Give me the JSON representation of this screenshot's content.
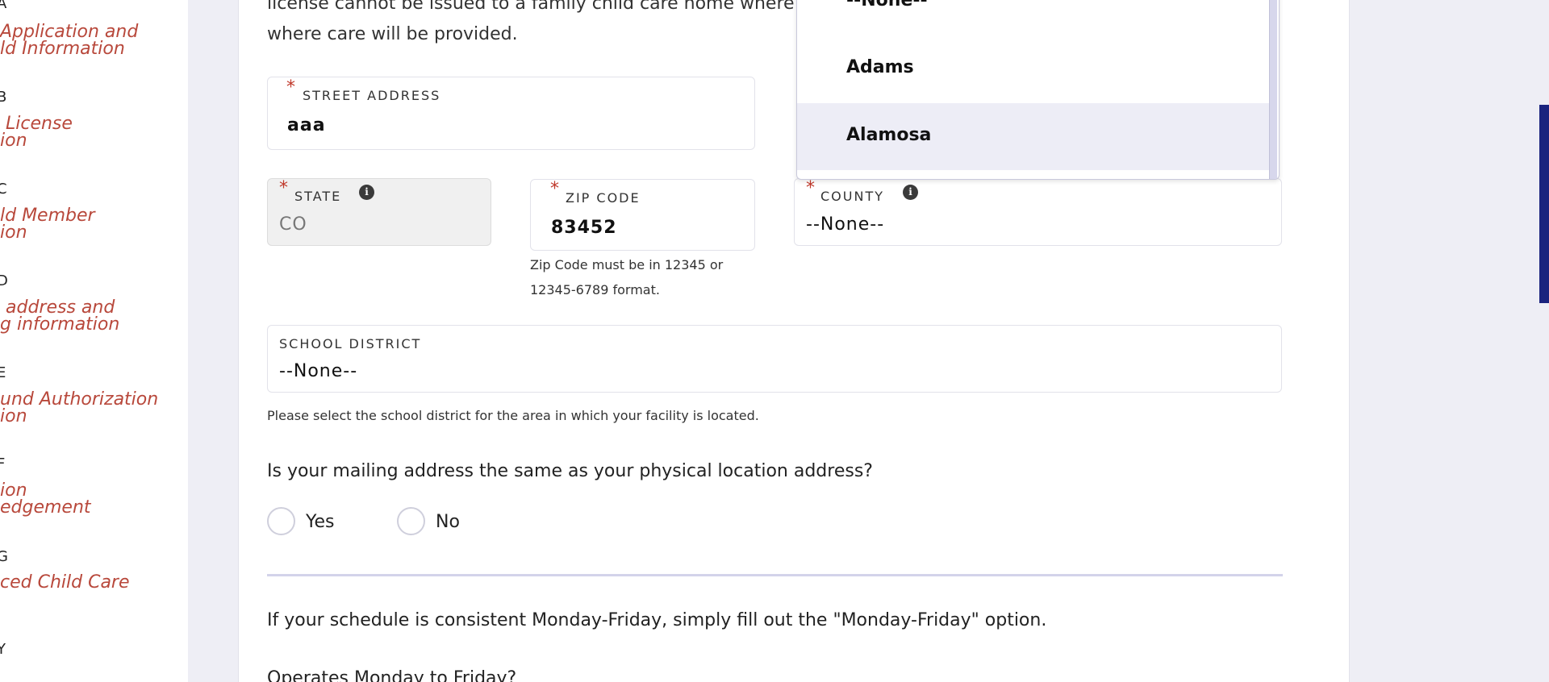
{
  "sidebar": {
    "steps": [
      {
        "step": "A",
        "label": "Application and\nld Information"
      },
      {
        "step": "B",
        "label": " License\nion"
      },
      {
        "step": "C",
        "label": "ld Member\nion"
      },
      {
        "step": "D",
        "label": " address and\ng information"
      },
      {
        "step": "E",
        "label": "und Authorization\nion"
      },
      {
        "step": "F",
        "label": "ion\nedgement"
      },
      {
        "step": "G",
        "label": "ced Child Care"
      },
      {
        "step": "Y",
        "label": ""
      }
    ]
  },
  "intro": {
    "line1": "license cannot be issued to a family child care home where",
    "line2": "where care will be provided."
  },
  "form": {
    "street": {
      "label": "STREET ADDRESS",
      "value": "aaa",
      "required": "*"
    },
    "state": {
      "label": "STATE",
      "value": "CO",
      "required": "*",
      "info_icon": "info-icon"
    },
    "zip": {
      "label": "ZIP CODE",
      "value": "83452",
      "required": "*",
      "help": "Zip Code must be in 12345 or\n12345-6789 format."
    },
    "county": {
      "label": "COUNTY",
      "value": "--None--",
      "required": "*",
      "info_icon": "info-icon"
    },
    "school_district": {
      "label": "SCHOOL DISTRICT",
      "value": "--None--",
      "help": "Please select the school district for the area in which your facility is located."
    }
  },
  "county_dropdown": {
    "options": [
      "--None--",
      "Adams",
      "Alamosa"
    ],
    "selected": "--None--",
    "hovered": "Alamosa"
  },
  "mailing": {
    "question": "Is your mailing address the same as your physical location address?",
    "options": [
      "Yes",
      "No"
    ]
  },
  "schedule": {
    "note": "If your schedule is consistent Monday-Friday, simply fill out the \"Monday-Friday\" option.",
    "question": "Operates Monday to Friday?"
  },
  "colors": {
    "accent": "#1a237e",
    "link": "#b8483b",
    "required": "#c0392b"
  }
}
